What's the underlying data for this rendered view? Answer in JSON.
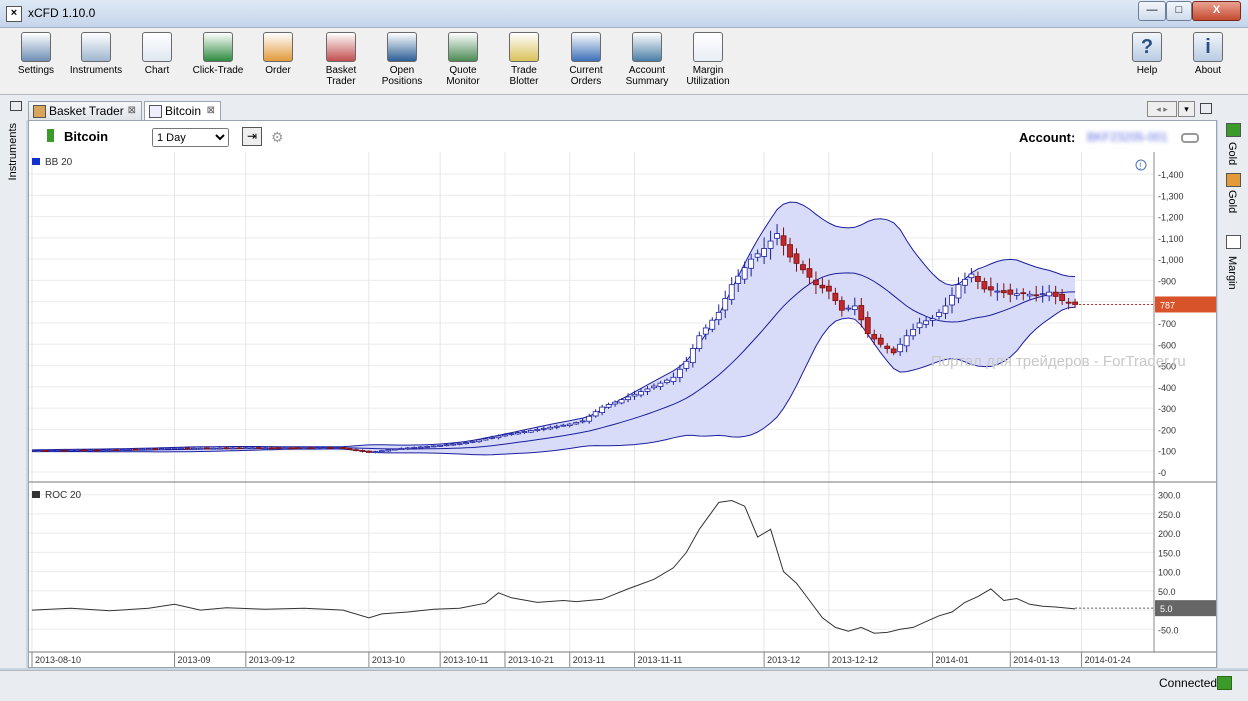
{
  "window": {
    "title": "xCFD 1.10.0",
    "minimize": "—",
    "maximize": "□",
    "close": "X"
  },
  "toolbar": {
    "left": [
      {
        "name": "settings",
        "label": "Settings",
        "icon": "gears-icon",
        "color": "#6f8fb5"
      },
      {
        "name": "instruments",
        "label": "Instruments",
        "icon": "list-icon",
        "color": "#9fb6cf"
      },
      {
        "name": "chart",
        "label": "Chart",
        "icon": "chart-icon",
        "color": "#dfe7f0"
      },
      {
        "name": "click-trade",
        "label": "Click-Trade",
        "icon": "buy-sell-icon",
        "color": "#2e8a3e"
      },
      {
        "name": "order",
        "label": "Order",
        "icon": "order-pencil-icon",
        "color": "#e29a3b"
      },
      {
        "name": "basket-trader",
        "label": "Basket\nTrader",
        "icon": "basket-icon",
        "color": "#c24f4f"
      },
      {
        "name": "open-positions",
        "label": "Open\nPositions",
        "icon": "briefcase-icon",
        "color": "#2b5f95"
      },
      {
        "name": "quote-monitor",
        "label": "Quote\nMonitor",
        "icon": "quote-monitor-icon",
        "color": "#4b8a55"
      },
      {
        "name": "trade-blotter",
        "label": "Trade\nBlotter",
        "icon": "blotter-icon",
        "color": "#d9c25a"
      },
      {
        "name": "current-orders",
        "label": "Current\nOrders",
        "icon": "gavel-icon",
        "color": "#3c70b8"
      },
      {
        "name": "account-summary",
        "label": "Account\nSummary",
        "icon": "calculator-icon",
        "color": "#4a7fa6"
      },
      {
        "name": "margin-utilization",
        "label": "Margin\nUtilization",
        "icon": "percent-icon",
        "color": "#e8eef5"
      }
    ],
    "right": [
      {
        "name": "help",
        "label": "Help",
        "icon": "help-icon",
        "glyph": "?"
      },
      {
        "name": "about",
        "label": "About",
        "icon": "info-icon",
        "glyph": "i"
      }
    ]
  },
  "tabs": [
    {
      "label": "Basket Trader",
      "active": false
    },
    {
      "label": "Bitcoin",
      "active": true
    }
  ],
  "side_left": {
    "label": "Instruments"
  },
  "side_right": [
    {
      "label": "Gold"
    },
    {
      "label": "Gold"
    },
    {
      "label": "Margin"
    }
  ],
  "chart_header": {
    "instrument": "Bitcoin",
    "period": "1 Day",
    "period_options": [
      "1 Day"
    ],
    "account_label": "Account:",
    "account_value": "BKF23205-001"
  },
  "watermark": "Портал для трейдеров - ForTrader.ru",
  "status": {
    "text": "Connected"
  },
  "colors": {
    "band_fill": "#d9dcf8",
    "band_line": "#1b1f9e",
    "up": "#ffffff",
    "down": "#c0282c",
    "price_tag": "#d9532a",
    "roc_tag": "#666666"
  },
  "chart_data": [
    {
      "type": "candlestick",
      "indicator": "BB 20",
      "ylim": [
        0,
        1400
      ],
      "y_ticks": [
        0,
        100,
        200,
        300,
        400,
        500,
        600,
        700,
        800,
        900,
        1000,
        1100,
        1200,
        1300,
        1400
      ],
      "last_price": 787,
      "x_ticks": [
        {
          "label": "2013-08-10",
          "i": 0
        },
        {
          "label": "2013-09",
          "i": 22
        },
        {
          "label": "2013-09-12",
          "i": 33
        },
        {
          "label": "2013-10",
          "i": 52
        },
        {
          "label": "2013-10-11",
          "i": 63
        },
        {
          "label": "2013-10-21",
          "i": 73
        },
        {
          "label": "2013-11",
          "i": 83
        },
        {
          "label": "2013-11-11",
          "i": 93
        },
        {
          "label": "2013-12",
          "i": 113
        },
        {
          "label": "2013-12-12",
          "i": 123
        },
        {
          "label": "2014-01",
          "i": 139
        },
        {
          "label": "2014-01-13",
          "i": 151
        },
        {
          "label": "2014-01-24",
          "i": 162
        }
      ],
      "ohlc_points": [
        [
          0,
          100
        ],
        [
          6,
          102
        ],
        [
          12,
          104
        ],
        [
          18,
          108
        ],
        [
          22,
          112
        ],
        [
          28,
          112
        ],
        [
          33,
          114
        ],
        [
          40,
          113
        ],
        [
          47,
          115
        ],
        [
          52,
          92
        ],
        [
          56,
          108
        ],
        [
          63,
          125
        ],
        [
          67,
          138
        ],
        [
          73,
          175
        ],
        [
          76,
          190
        ],
        [
          80,
          210
        ],
        [
          83,
          225
        ],
        [
          85,
          240
        ],
        [
          88,
          305
        ],
        [
          91,
          340
        ],
        [
          95,
          390
        ],
        [
          99,
          445
        ],
        [
          101,
          520
        ],
        [
          103,
          640
        ],
        [
          106,
          750
        ],
        [
          108,
          880
        ],
        [
          111,
          1000
        ],
        [
          113,
          1050
        ],
        [
          115,
          1120
        ],
        [
          117,
          1010
        ],
        [
          119,
          950
        ],
        [
          121,
          880
        ],
        [
          123,
          850
        ],
        [
          125,
          760
        ],
        [
          127,
          780
        ],
        [
          129,
          650
        ],
        [
          131,
          600
        ],
        [
          133,
          560
        ],
        [
          135,
          640
        ],
        [
          137,
          700
        ],
        [
          139,
          720
        ],
        [
          141,
          780
        ],
        [
          143,
          880
        ],
        [
          145,
          930
        ],
        [
          147,
          860
        ],
        [
          149,
          850
        ],
        [
          151,
          835
        ],
        [
          153,
          840
        ],
        [
          155,
          830
        ],
        [
          157,
          845
        ],
        [
          159,
          805
        ],
        [
          161,
          787
        ]
      ]
    },
    {
      "type": "line",
      "indicator": "ROC 20",
      "ylim": [
        -70,
        320
      ],
      "y_ticks": [
        -50,
        0,
        50,
        100,
        150,
        200,
        250,
        300
      ],
      "last_value": 5,
      "x": [
        0,
        6,
        12,
        18,
        22,
        26,
        30,
        36,
        42,
        48,
        52,
        54,
        58,
        62,
        66,
        70,
        72,
        74,
        78,
        82,
        84,
        88,
        92,
        96,
        99,
        101,
        103,
        106,
        108,
        110,
        112,
        114,
        116,
        118,
        120,
        122,
        124,
        126,
        128,
        130,
        132,
        134,
        136,
        138,
        140,
        142,
        144,
        146,
        148,
        150,
        152,
        154,
        156,
        158,
        160,
        161
      ],
      "values": [
        0,
        5,
        -2,
        5,
        15,
        0,
        6,
        2,
        5,
        0,
        -20,
        -10,
        -5,
        2,
        5,
        18,
        45,
        32,
        20,
        25,
        22,
        28,
        55,
        80,
        110,
        150,
        210,
        280,
        285,
        270,
        190,
        210,
        100,
        70,
        25,
        -20,
        -45,
        -55,
        -45,
        -60,
        -58,
        -50,
        -45,
        -30,
        -15,
        -5,
        20,
        35,
        55,
        25,
        30,
        15,
        10,
        8,
        5,
        3
      ]
    }
  ]
}
